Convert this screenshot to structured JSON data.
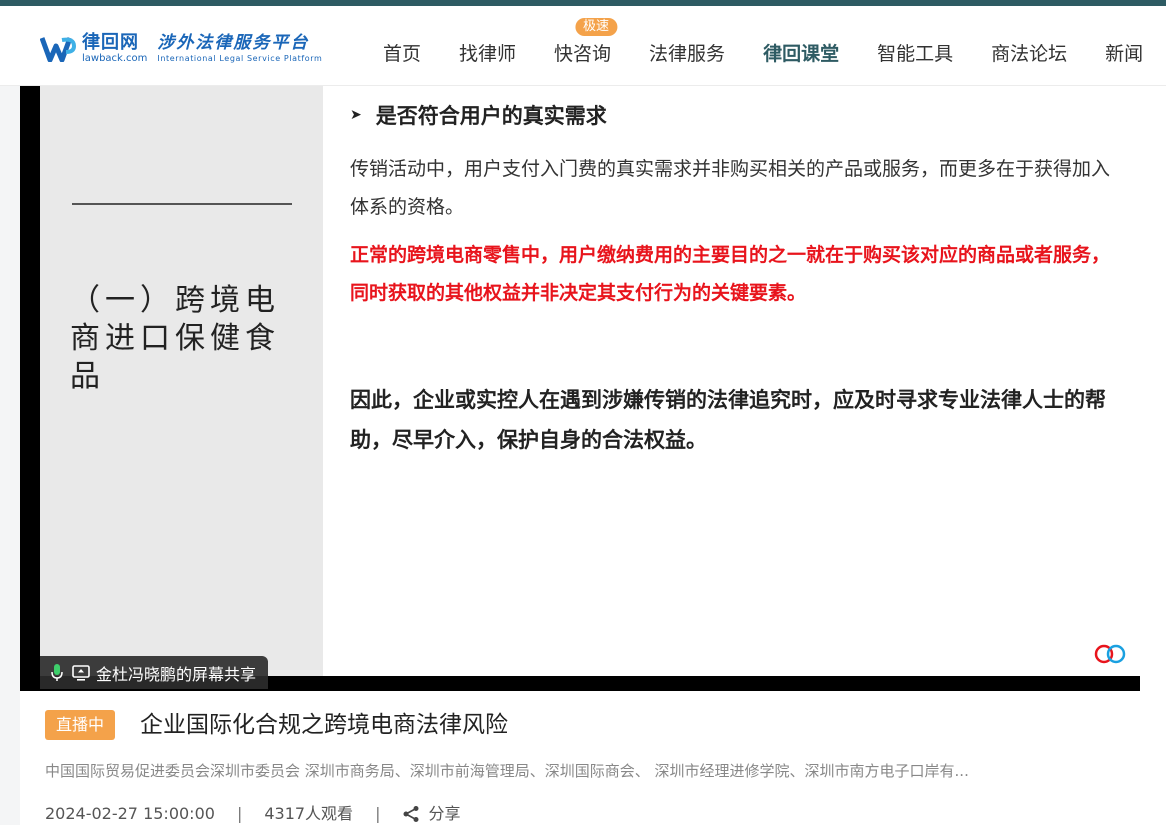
{
  "brand": {
    "name_cn": "律回网",
    "name_en": "lawback.com",
    "slogan_cn": "涉外法律服务平台",
    "slogan_en": "International Legal Service Platform"
  },
  "nav": {
    "items": [
      {
        "label": "首页"
      },
      {
        "label": "找律师"
      },
      {
        "label": "快咨询",
        "badge": "极速"
      },
      {
        "label": "法律服务"
      },
      {
        "label": "律回课堂",
        "active": true
      },
      {
        "label": "智能工具"
      },
      {
        "label": "商法论坛"
      },
      {
        "label": "新闻"
      }
    ]
  },
  "slide": {
    "section_title": "（一）跨境电商进口保健食品",
    "bullet": "是否符合用户的真实需求",
    "para1": "传销活动中，用户支付入门费的真实需求并非购买相关的产品或服务，而更多在于获得加入体系的资格。",
    "para2": "正常的跨境电商零售中，用户缴纳费用的主要目的之一就在于购买该对应的商品或者服务，同时获取的其他权益并非决定其支付行为的关键要素。",
    "para3": "因此，企业或实控人在遇到涉嫌传销的法律追究时，应及时寻求专业法律人士的帮助，尽早介入，保护自身的合法权益。"
  },
  "screen_share": {
    "label": "金杜冯晓鹏的屏幕共享"
  },
  "course": {
    "live_badge": "直播中",
    "title": "企业国际化合规之跨境电商法律风险",
    "organizers": "中国国际贸易促进委员会深圳市委员会 深圳市商务局、深圳市前海管理局、深圳国际商会、 深圳市经理进修学院、深圳市南方电子口岸有...",
    "datetime": "2024-02-27 15:00:00",
    "separator": "|",
    "views": "4317人观看",
    "share_label": "分享"
  },
  "colors": {
    "brand_teal": "#2e5b63",
    "brand_blue": "#1a66b8",
    "accent_orange": "#f4a24a",
    "alert_red": "#e8141c"
  }
}
